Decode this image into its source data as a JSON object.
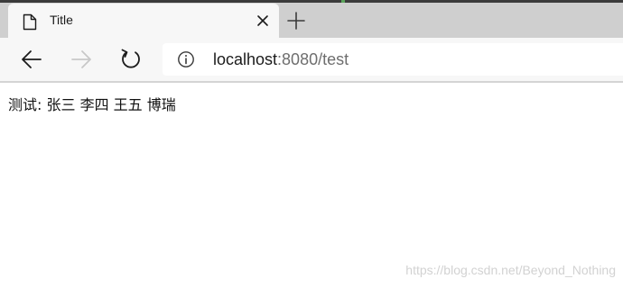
{
  "browser": {
    "tab": {
      "title": "Title",
      "icon": "page-icon",
      "close_icon": "close-icon"
    },
    "new_tab_icon": "plus-icon",
    "toolbar": {
      "back_icon": "arrow-left-icon",
      "forward_icon": "arrow-right-icon",
      "forward_enabled": false,
      "refresh_icon": "refresh-icon",
      "address": {
        "info_icon": "info-icon",
        "host": "localhost",
        "rest": ":8080/test"
      }
    }
  },
  "page": {
    "content_text": "测试: 张三 李四 王五 博瑞"
  },
  "watermark": "https://blog.csdn.net/Beyond_Nothing",
  "colors": {
    "tab_bar": "#cfcfcf",
    "tab_active": "#f7f7f7",
    "address_bg": "#ffffff",
    "url_rest": "#6e6e6e"
  }
}
